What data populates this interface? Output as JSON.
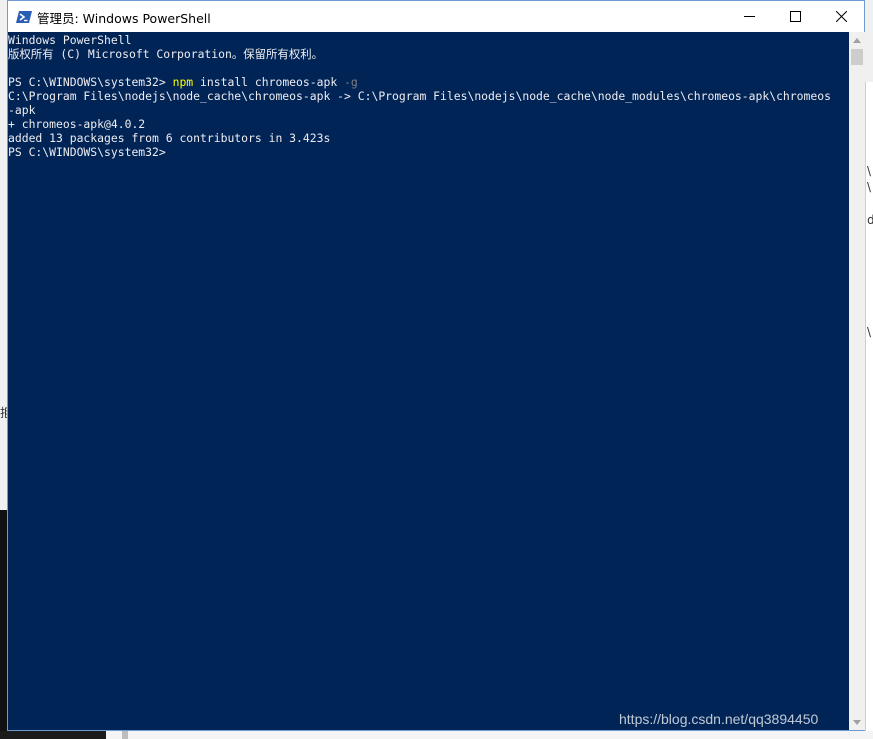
{
  "window": {
    "title": "管理员: Windows PowerShell",
    "controls": {
      "minimize": "—",
      "maximize": "☐",
      "close": "✕"
    }
  },
  "console": {
    "lines": [
      [
        {
          "t": "Windows PowerShell"
        }
      ],
      [
        {
          "t": "版权所有 (C) Microsoft Corporation。保留所有权利。"
        }
      ],
      [
        {
          "t": ""
        }
      ],
      [
        {
          "t": "PS C:\\WINDOWS\\system32> "
        },
        {
          "t": "npm",
          "c": "yellow"
        },
        {
          "t": " install chromeos-apk "
        },
        {
          "t": "-g",
          "c": "gray"
        }
      ],
      [
        {
          "t": "C:\\Program Files\\nodejs\\node_cache\\chromeos-apk -> C:\\Program Files\\nodejs\\node_cache\\node_modules\\chromeos-apk\\chromeos"
        }
      ],
      [
        {
          "t": "-apk"
        }
      ],
      [
        {
          "t": "+ chromeos-apk@4.0.2"
        }
      ],
      [
        {
          "t": "added 13 packages from 6 contributors in 3.423s"
        }
      ],
      [
        {
          "t": "PS C:\\WINDOWS\\system32>"
        }
      ]
    ]
  },
  "watermark": "https://blog.csdn.net/qq3894450",
  "background": {
    "right_fragments": [
      "\\",
      "\\",
      "d",
      "\\"
    ],
    "left_fragment": "拒"
  },
  "colors": {
    "console_bg": "#012456",
    "console_fg": "#eeedf0",
    "command": "#ffff00",
    "parameter": "#7f7f7f"
  },
  "icons": {
    "app": "powershell-icon"
  }
}
